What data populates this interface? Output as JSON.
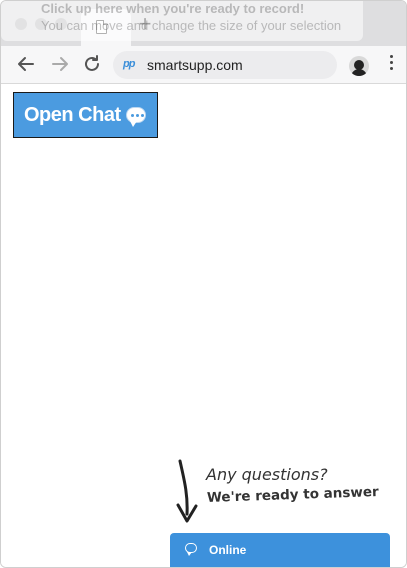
{
  "recorder_banner": {
    "line1": "Click up here when you're ready to record!",
    "line2": "You can move and change the size of your selection"
  },
  "browser": {
    "tab_icon": "blank-page-icon",
    "new_tab_label": "+",
    "url": "smartsupp.com",
    "site_icon_text": "pp"
  },
  "page": {
    "open_chat_label": "Open Chat",
    "teaser_line1": "Any questions?",
    "teaser_line2": "We're ready to answer",
    "chat_status": "Online"
  },
  "colors": {
    "accent": "#3d91dc",
    "button_bg": "#4b9be0"
  }
}
